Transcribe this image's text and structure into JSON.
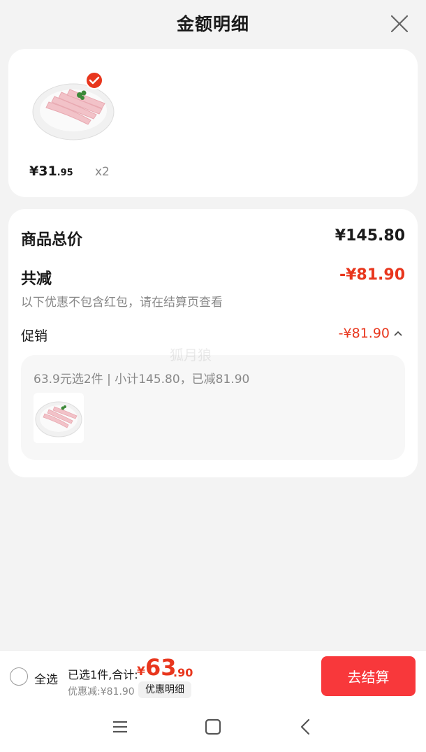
{
  "header": {
    "title": "金额明细"
  },
  "product": {
    "price_main": "¥31",
    "price_cents": ".95",
    "quantity": "x2",
    "selected": true
  },
  "summary": {
    "subtotal_label": "商品总价",
    "subtotal_value": "¥145.80",
    "discount_label": "共减",
    "discount_value": "-¥81.90",
    "discount_note": "以下优惠不包含红包，请在结算页查看",
    "promo_label": "促销",
    "promo_value": "-¥81.90",
    "promo_detail": "63.9元选2件 | 小计145.80，已减81.90"
  },
  "watermark": "狐月狼",
  "bottom": {
    "select_all": "全选",
    "selected_info": "已选1件,合计:",
    "total_currency": "¥",
    "total_int": "63",
    "total_dec": ".90",
    "discount_info": "优惠减:¥81.90",
    "detail_chip": "优惠明细",
    "checkout": "去结算"
  },
  "colors": {
    "accent_red": "#e8361d",
    "button_red": "#f8383b"
  }
}
